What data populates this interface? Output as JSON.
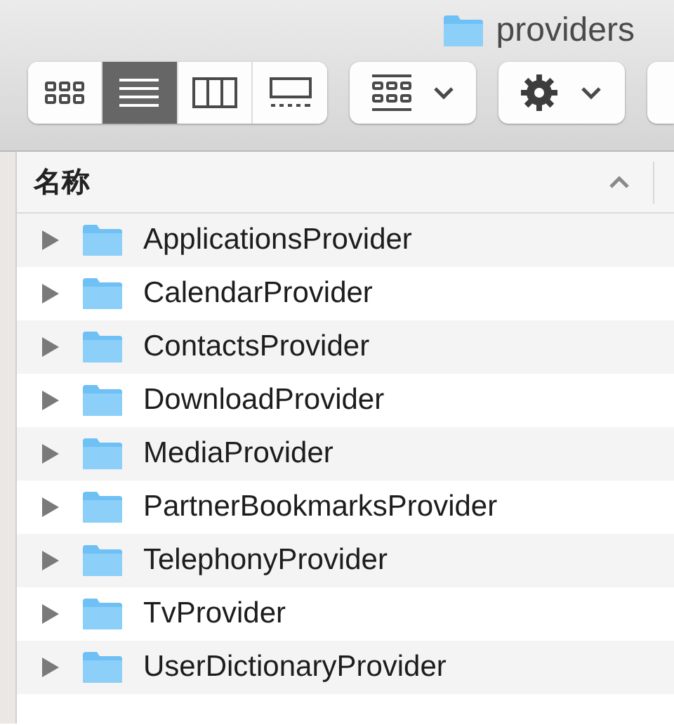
{
  "window": {
    "title": "providers"
  },
  "toolbar": {
    "view_buttons": [
      {
        "kind": "icons",
        "selected": false
      },
      {
        "kind": "list",
        "selected": true
      },
      {
        "kind": "columns",
        "selected": false
      },
      {
        "kind": "gallery",
        "selected": false
      }
    ]
  },
  "table": {
    "columns": [
      {
        "label": "名称",
        "sorted_ascending": true
      }
    ],
    "rows": [
      {
        "name": "ApplicationsProvider",
        "expanded": false
      },
      {
        "name": "CalendarProvider",
        "expanded": false
      },
      {
        "name": "ContactsProvider",
        "expanded": false
      },
      {
        "name": "DownloadProvider",
        "expanded": false
      },
      {
        "name": "MediaProvider",
        "expanded": false
      },
      {
        "name": "PartnerBookmarksProvider",
        "expanded": false
      },
      {
        "name": "TelephonyProvider",
        "expanded": false
      },
      {
        "name": "TvProvider",
        "expanded": false
      },
      {
        "name": "UserDictionaryProvider",
        "expanded": false
      }
    ]
  }
}
